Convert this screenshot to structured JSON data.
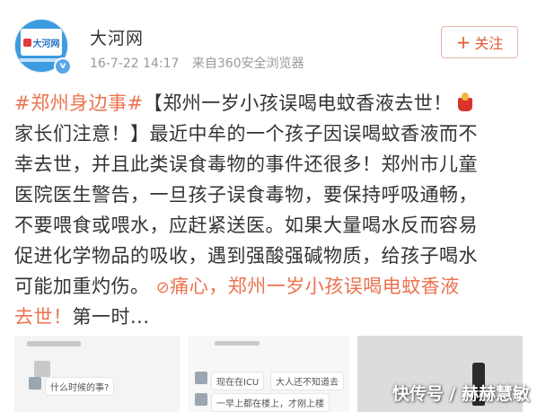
{
  "author": {
    "avatar_logo_text": "大河网",
    "name": "大河网",
    "date": "16-7-22 14:17",
    "source": "来自360安全浏览器"
  },
  "follow": {
    "plus": "+",
    "label": "关注"
  },
  "post": {
    "hashtag": "#郑州身边事#",
    "line1_text": "【郑州一岁小孩误喝电蚊香液去世！",
    "line2_text": "家长们注意！】最近中牟的一个孩子因误喝蚊香液而不",
    "line3_text": "幸去世，并且此类误食毒物的事件还很多！郑州市儿童",
    "line4_text": "医院医生警告，一旦孩子误食毒物，要保持呼吸通畅，",
    "line5_text": "不要喂食或喂水，应赶紧送医。如果大量喝水反而容易",
    "line6_text": "促进化学物品的吸收，遇到强酸强碱物质，给孩子喝水",
    "line7_text": "可能加重灼伤。",
    "link_icon": "⊘",
    "link_line7": "痛心，郑州一岁小孩误喝电蚊香液",
    "line8_link": "去世！",
    "line8_more": "第一时..."
  },
  "thumbs": {
    "thumb1_bubble": "什么时候的事?",
    "thumb2_bubble_a": "现在在ICU",
    "thumb2_bubble_b": "大人还不知道去",
    "thumb2_bubble_c": "一早上都在楼上，才刚上楼"
  },
  "watermark": "快传号 / 赫赫慧敏",
  "colors": {
    "accent": "#eb7350",
    "text": "#333333",
    "meta": "#999999",
    "avatar_bg": "#3d9be0"
  },
  "icons": {
    "verify": "verified-badge-icon",
    "follow": "plus-icon",
    "emoji": "red-cup-emoji-icon",
    "link": "link-icon"
  }
}
